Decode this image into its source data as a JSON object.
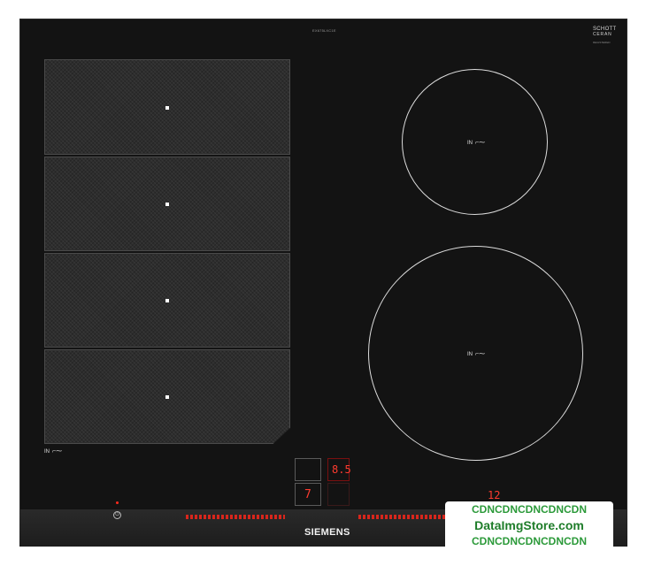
{
  "cooktop": {
    "model_code": "EX675LXC1E",
    "glass_brand": {
      "line1": "SCHOTT",
      "line2": "CERAN",
      "line3": "REGISTERED"
    },
    "zone_label": "IN",
    "pan_symbol": "⌐⁓",
    "flex_zone_count": 4,
    "brand": "SIEMENS",
    "displays": {
      "top_right": "8.5",
      "lower_left": "7",
      "timer": "12"
    },
    "accent_color": "#ff3b2f"
  },
  "watermark": {
    "line1": "CDNCDNCDNCDNCDN",
    "line2": "DataImgStore.com",
    "line3": "CDNCDNCDNCDNCDN"
  }
}
